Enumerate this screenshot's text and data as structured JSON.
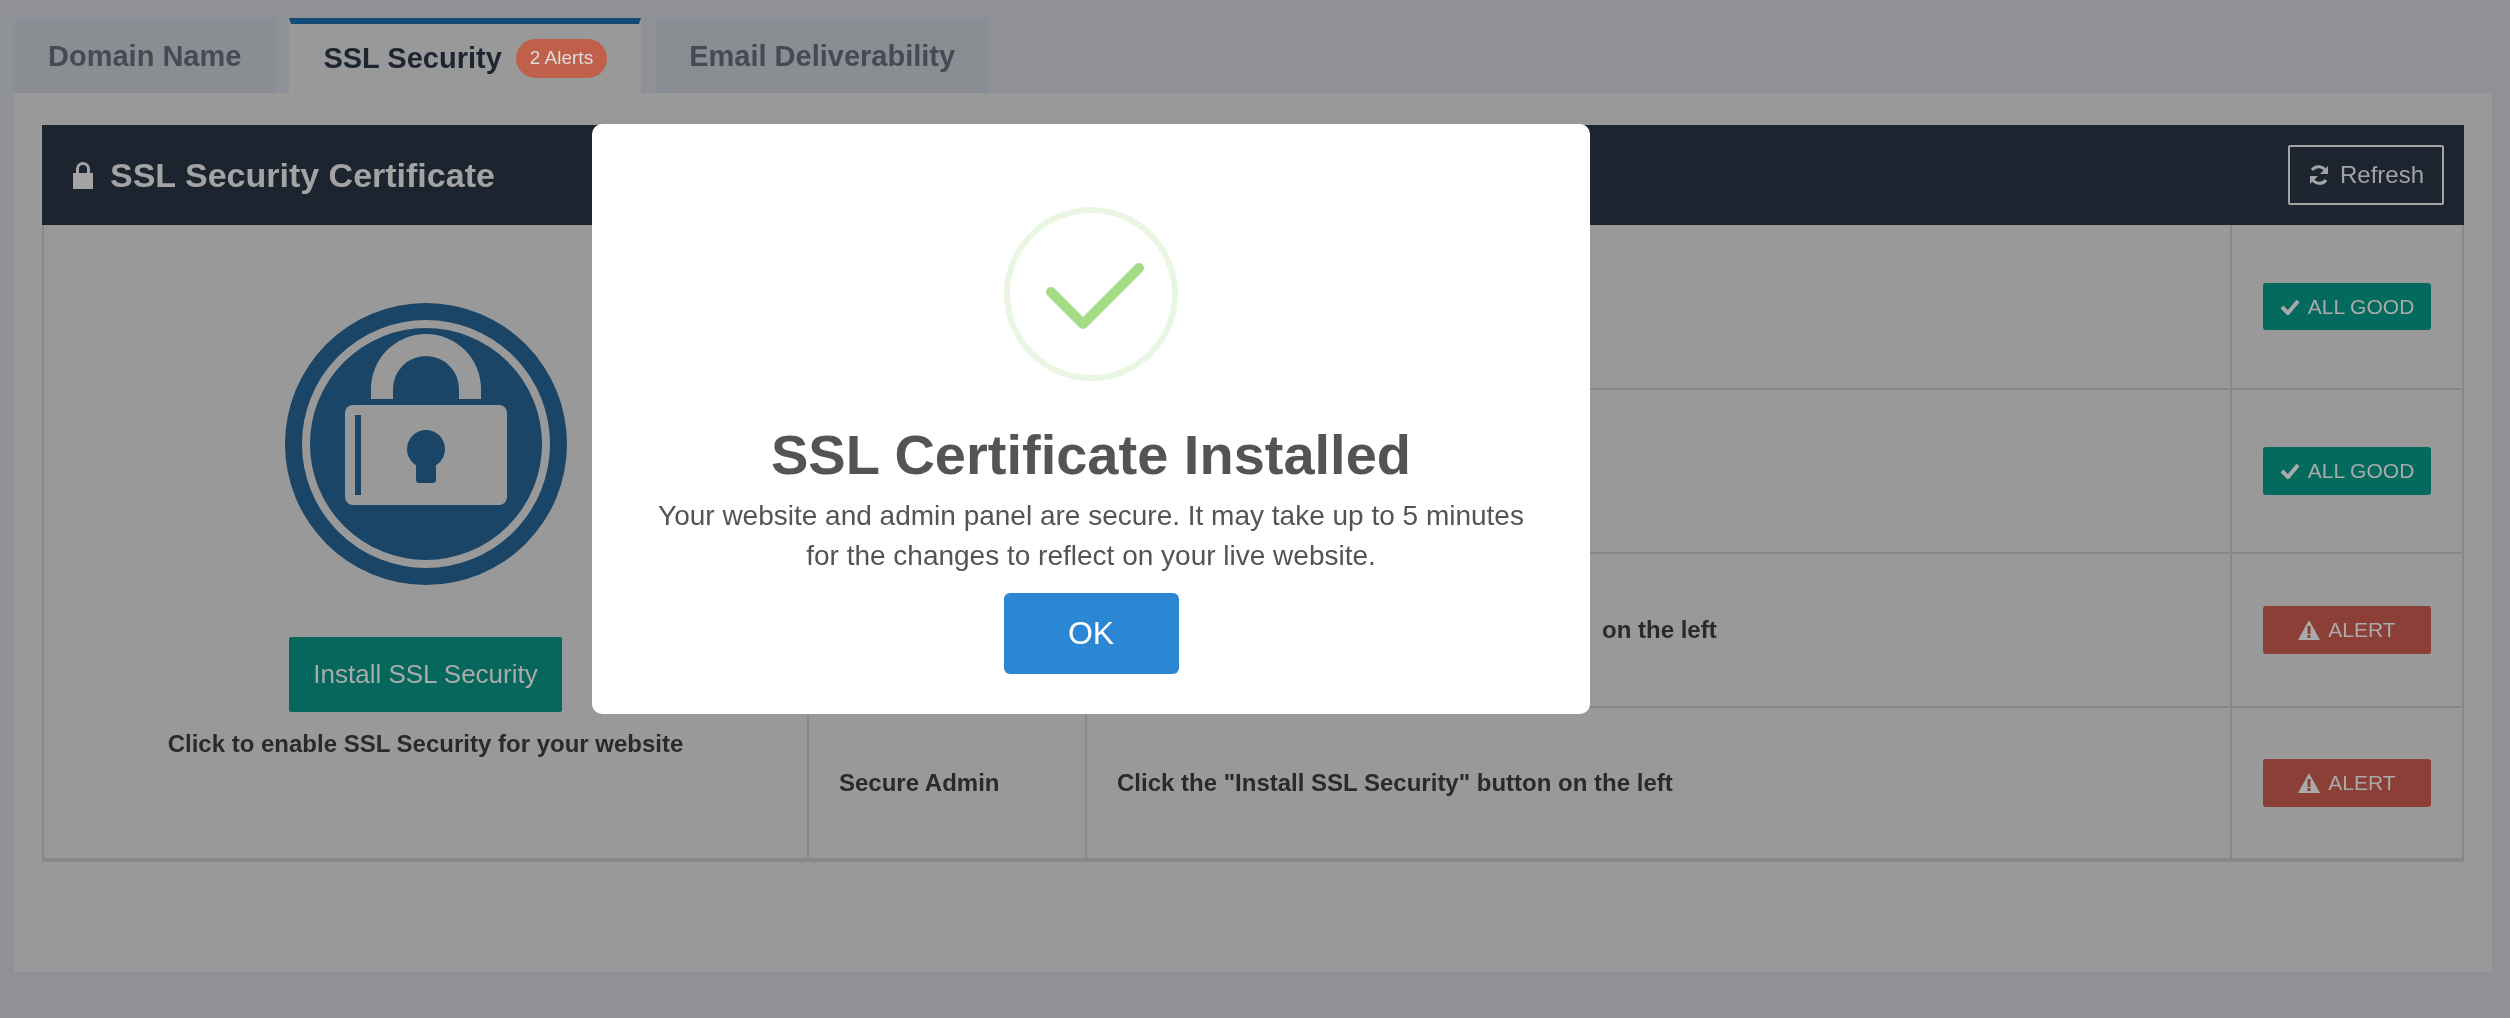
{
  "tabs": [
    {
      "label": "Domain Name",
      "selected": false
    },
    {
      "label": "SSL Security",
      "selected": true,
      "badge": "2 Alerts"
    },
    {
      "label": "Email Deliverability",
      "selected": false
    }
  ],
  "card": {
    "title": "SSL Security Certificate",
    "refresh_button": "Refresh",
    "install_button": "Install SSL Security",
    "install_caption": "Click to enable SSL Security for your website",
    "rows": [
      {
        "status": "ALL GOOD",
        "kind": "good"
      },
      {
        "status": "ALL GOOD",
        "kind": "good"
      },
      {
        "description": "on the left",
        "status": "ALERT",
        "kind": "alert"
      },
      {
        "label": "Secure Admin",
        "description": "Click the \"Install SSL Security\" button on the left",
        "status": "ALERT",
        "kind": "alert"
      }
    ]
  },
  "modal": {
    "title": "SSL Certificate Installed",
    "message": "Your website and admin panel are secure. It may take up to 5 minutes for the changes to reflect on your live website.",
    "ok_button": "OK"
  }
}
